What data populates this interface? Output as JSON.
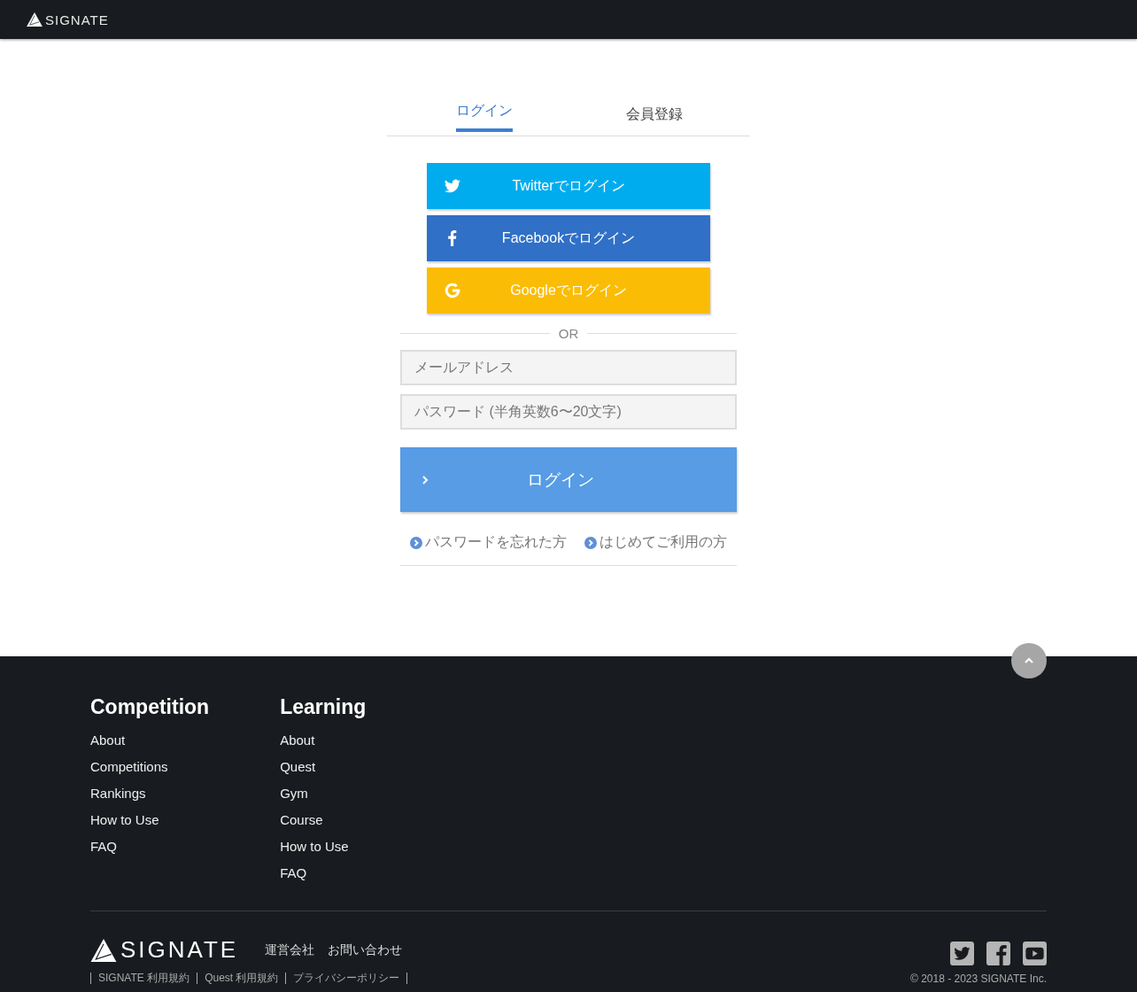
{
  "header": {
    "logo": "SIGNATE"
  },
  "tabs": [
    {
      "label": "ログイン",
      "selected": true
    },
    {
      "label": "会員登録",
      "selected": false
    }
  ],
  "social_buttons": [
    {
      "kind": "twitter",
      "label": "Twitterでログイン",
      "color": "#00acee"
    },
    {
      "kind": "facebook",
      "label": "Facebookでログイン",
      "color": "#3070c6"
    },
    {
      "kind": "google",
      "label": "Googleでログイン",
      "color": "#fbbc05"
    }
  ],
  "divider": "OR",
  "fields": [
    {
      "placeholder": "メールアドレス"
    },
    {
      "placeholder": "パスワード (半角英数6〜20文字)"
    }
  ],
  "submit": "ログイン",
  "links": [
    "パスワードを忘れた方",
    "はじめてご利用の方"
  ],
  "footer": {
    "columns": [
      {
        "title": "Competition",
        "items": [
          "About",
          "Competitions",
          "Rankings",
          "How to Use",
          "FAQ"
        ]
      },
      {
        "title": "Learning",
        "items": [
          "About",
          "Quest",
          "Gym",
          "Course",
          "How to Use",
          "FAQ"
        ]
      }
    ],
    "logo": "SIGNATE",
    "company_links": [
      "運営会社",
      "お問い合わせ"
    ],
    "legal_links": [
      "SIGNATE 利用規約",
      "Quest 利用規約",
      "プライバシーポリシー"
    ],
    "copyright": "© 2018 - 2023 SIGNATE Inc."
  }
}
